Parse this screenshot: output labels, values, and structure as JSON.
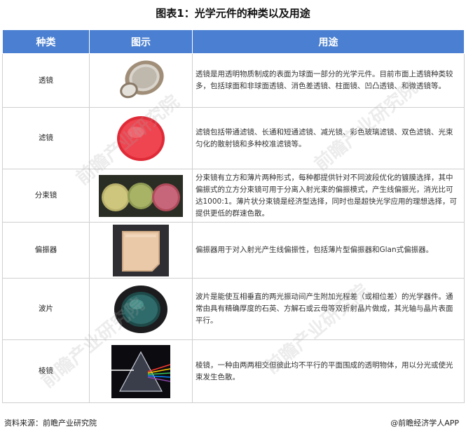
{
  "title": "图表1：光学元件的种类以及用途",
  "table": {
    "headers": [
      "种类",
      "图示",
      "用途"
    ],
    "rows": [
      {
        "name": "透镜",
        "icon": "lens-image",
        "desc": "透镜是用透明物质制成的表面为球面一部分的光学元件。目前市面上透镜种类较多，包括球面和非球面透镜、消色差透镜、柱面镜、凹凸透镜、和微透镜等。"
      },
      {
        "name": "滤镜",
        "icon": "filter-image",
        "desc": "滤镜包括带通滤镜、长通和短通滤镜、减光镜、彩色玻璃滤镜、双色滤镜、光束匀化的散射镜和多种校准滤镜等。"
      },
      {
        "name": "分束镜",
        "icon": "beam-splitter-image",
        "desc": "分束镜有立方和薄片两种形式，每种都提供针对不同波段优化的镀膜选择，其中偏振式的立方分束镜可用于分离入射光束的偏振模式，产生线偏振光，消光比可达1000:1。薄片状分束镜是经济型选择，同时也是超快光学应用的理想选择，可提供更低的群速色散。"
      },
      {
        "name": "偏振器",
        "icon": "polarizer-image",
        "desc": "偏振器用于对入射光产生线偏振性，包括薄片型偏振器和Glan式偏振器。"
      },
      {
        "name": "波片",
        "icon": "wave-plate-image",
        "desc": "波片是能使互相垂直的两光振动间产生附加光程差（或相位差）的光学器件。通常由具有精确厚度的石英、方解石或云母等双折射晶片做成，其光轴与晶片表面平行。"
      },
      {
        "name": "棱镜",
        "icon": "prism-image",
        "desc": "棱镜，一种由两两相交但彼此均不平行的平面围成的透明物体，用以分光或使光束发生色散。"
      }
    ]
  },
  "footer": {
    "source": "资料来源：前瞻产业研究院",
    "brand": "@前瞻经济学人APP"
  },
  "watermark": "前瞻产业研究院",
  "colors": {
    "header_bg": "#4a7fd1",
    "filter_red": "#e8333f"
  }
}
